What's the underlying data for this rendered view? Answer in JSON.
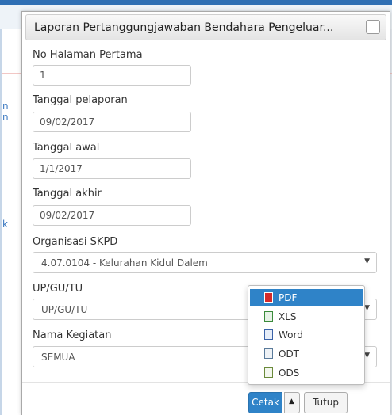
{
  "dialog": {
    "title": "Laporan Pertanggungjawaban Bendahara Pengeluar...",
    "fields": {
      "no_halaman": {
        "label": "No Halaman Pertama",
        "value": "1"
      },
      "tgl_pelaporan": {
        "label": "Tanggal pelaporan",
        "value": "09/02/2017"
      },
      "tgl_awal": {
        "label": "Tanggal awal",
        "value": "1/1/2017"
      },
      "tgl_akhir": {
        "label": "Tanggal akhir",
        "value": "09/02/2017"
      },
      "organisasi": {
        "label": "Organisasi SKPD",
        "value": "4.07.0104 - Kelurahan Kidul Dalem"
      },
      "upgutu": {
        "label": "UP/GU/TU",
        "value": "UP/GU/TU"
      },
      "kegiatan": {
        "label": "Nama Kegiatan",
        "value": "SEMUA"
      }
    },
    "buttons": {
      "cetak": "Cetak",
      "tutup": "Tutup"
    },
    "export_menu": {
      "items": [
        {
          "label": "PDF",
          "icon": "pdf-icon",
          "active": true
        },
        {
          "label": "XLS",
          "icon": "xls-icon"
        },
        {
          "label": "Word",
          "icon": "word-icon"
        },
        {
          "label": "ODT",
          "icon": "odt-icon"
        },
        {
          "label": "ODS",
          "icon": "ods-icon"
        }
      ]
    }
  },
  "background": {
    "left_fragments": [
      "n",
      "n",
      "k"
    ]
  },
  "colors": {
    "primary": "#2f83c8",
    "topbar": "#2f6fb4"
  }
}
